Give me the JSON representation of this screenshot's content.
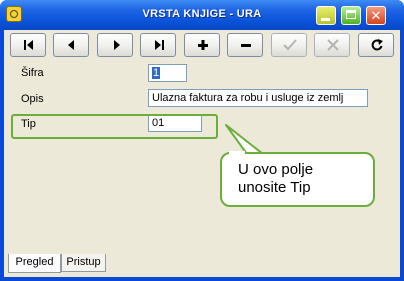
{
  "window": {
    "title": "VRSTA KNJIGE - URA"
  },
  "toolbar": {
    "buttons": [
      {
        "icon": "first-record-icon"
      },
      {
        "icon": "previous-record-icon"
      },
      {
        "icon": "next-record-icon"
      },
      {
        "icon": "last-record-icon"
      },
      {
        "icon": "plus-icon"
      },
      {
        "icon": "minus-icon"
      },
      {
        "icon": "checkmark-icon"
      },
      {
        "icon": "cross-icon"
      },
      {
        "icon": "refresh-icon"
      }
    ]
  },
  "form": {
    "sifra": {
      "label": "Šifra",
      "value": "1"
    },
    "opis": {
      "label": "Opis",
      "value": "Ulazna faktura za robu i usluge iz zemlj"
    },
    "tip": {
      "label": "Tip",
      "value": "01"
    }
  },
  "callout": {
    "line1": "U ovo polje",
    "line2": "unosite Tip"
  },
  "tabs": [
    "Pregled",
    "Pristup"
  ],
  "colors": {
    "title_bar": "#0a53d9",
    "highlight": "#6cae3c",
    "selection": "#316ac5"
  }
}
